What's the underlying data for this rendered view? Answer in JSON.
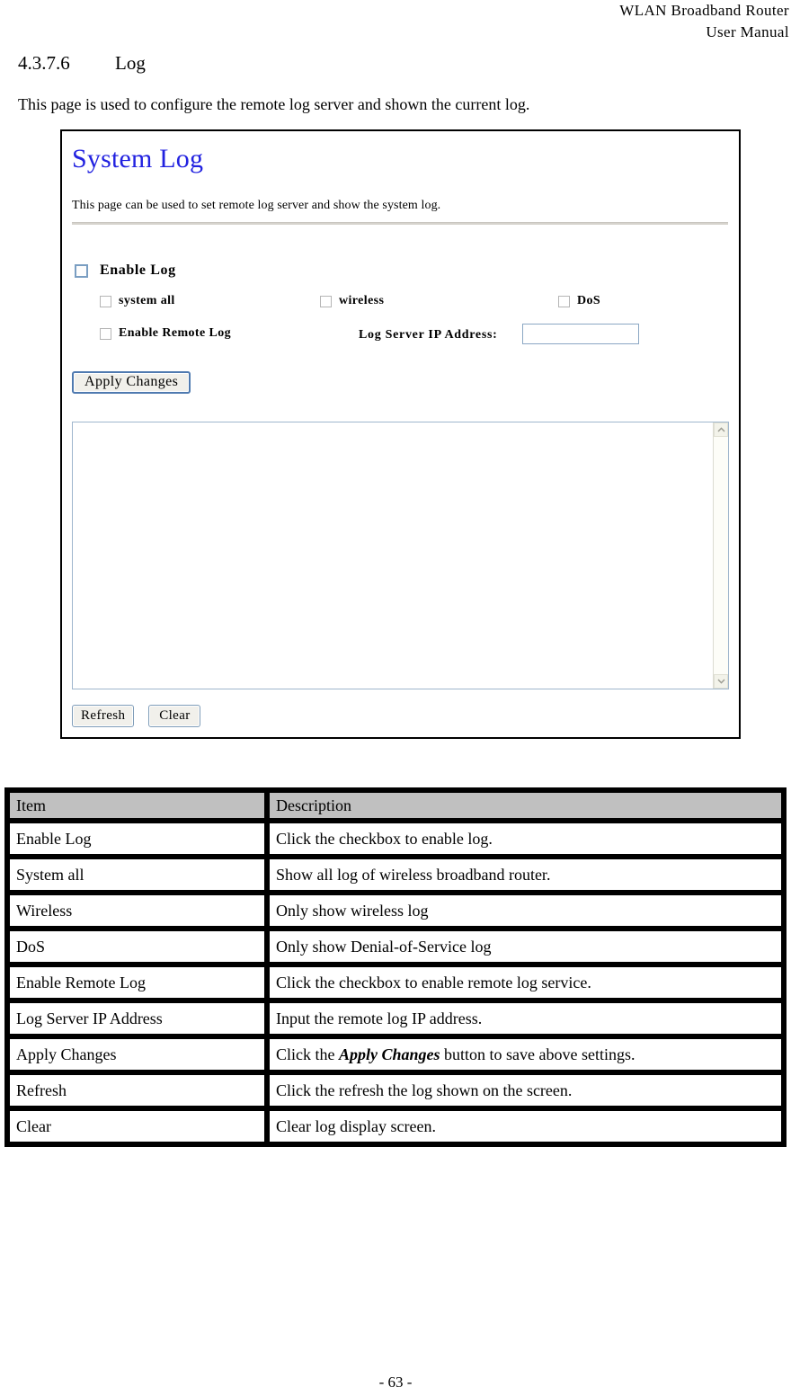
{
  "header": {
    "line1": "WLAN  Broadband  Router",
    "line2": "User  Manual"
  },
  "section": {
    "number": "4.3.7.6",
    "title": "Log"
  },
  "intro": "This page is used to configure the remote log server and shown the current log.",
  "screenshot": {
    "title": "System Log",
    "description": "This page can be used to set remote log server and show the system log.",
    "enable_log_label": "Enable Log",
    "filters": [
      {
        "label": "system all"
      },
      {
        "label": "wireless"
      },
      {
        "label": "DoS"
      }
    ],
    "enable_remote_log_label": "Enable Remote Log",
    "log_server_ip_label": "Log Server IP Address:",
    "log_server_ip_value": "",
    "log_server_ip_placeholder": "",
    "apply_changes_label": "Apply Changes",
    "log_text": "",
    "refresh_label": "Refresh",
    "clear_label": "Clear",
    "scroll_up_icon": "chevron-up-icon",
    "scroll_down_icon": "chevron-down-icon"
  },
  "table": {
    "headers": [
      "Item",
      "Description"
    ],
    "rows": [
      {
        "item": "Enable Log",
        "desc": "Click the checkbox to enable log."
      },
      {
        "item": "System all",
        "desc": "Show all log of wireless broadband router."
      },
      {
        "item": "Wireless",
        "desc": "Only show wireless log"
      },
      {
        "item": "DoS",
        "desc": "Only show Denial-of-Service log"
      },
      {
        "item": "Enable Remote Log",
        "desc": "Click the checkbox to enable remote log service."
      },
      {
        "item": "Log Server IP Address",
        "desc": "Input the remote log IP address."
      },
      {
        "item": "Apply Changes",
        "desc_pre": "Click the ",
        "desc_em": "Apply Changes",
        "desc_post": " button to save above settings."
      },
      {
        "item": "Refresh",
        "desc": "Click the refresh the log shown on the screen."
      },
      {
        "item": "Clear",
        "desc": "Clear log display screen."
      }
    ]
  },
  "footer": {
    "page_number": "- 63 -"
  },
  "colors": {
    "shot_title": "#2222e0",
    "table_header_bg": "#c0c0c0",
    "button_border": "#7f9db9"
  }
}
